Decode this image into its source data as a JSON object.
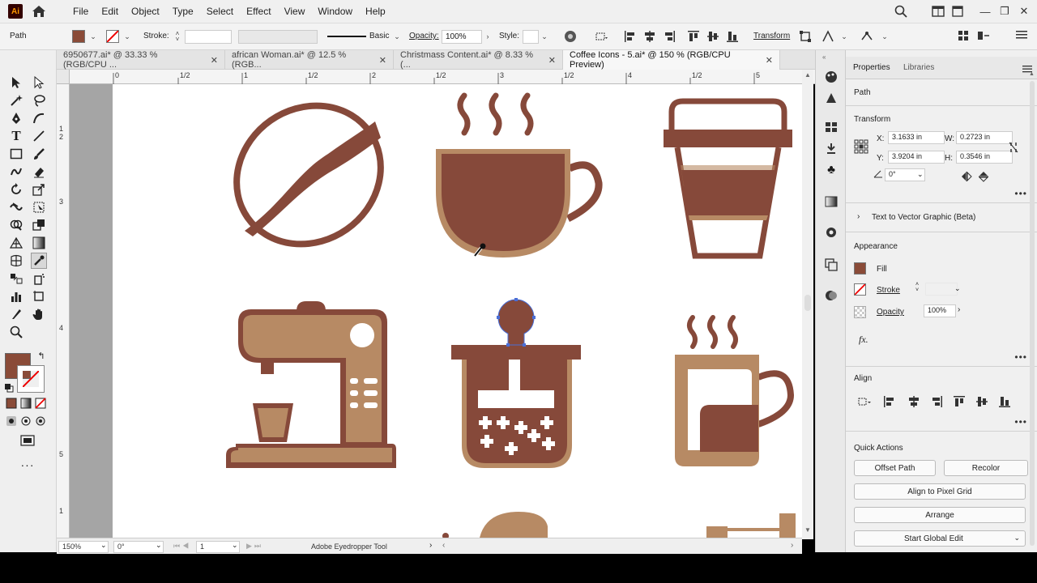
{
  "app": {
    "logo_text": "Ai"
  },
  "menu": [
    "File",
    "Edit",
    "Object",
    "Type",
    "Select",
    "Effect",
    "View",
    "Window",
    "Help"
  ],
  "control_bar": {
    "selection_type": "Path",
    "stroke_label": "Stroke:",
    "brush_label": "Basic",
    "opacity_label": "Opacity:",
    "opacity_value": "100%",
    "style_label": "Style:",
    "transform_label": "Transform",
    "fill_color": "#8a4b38"
  },
  "tabs": [
    {
      "label": "6950677.ai* @ 33.33 % (RGB/CPU ..."
    },
    {
      "label": "african Woman.ai* @ 12.5 % (RGB..."
    },
    {
      "label": "Christmass Content.ai* @ 8.33 % (..."
    },
    {
      "label": "Coffee Icons - 5.ai* @ 150 % (RGB/CPU Preview)"
    }
  ],
  "ruler": {
    "h_labels": [
      "0",
      "1/2",
      "1",
      "1/2",
      "2",
      "1/2",
      "3",
      "1/2",
      "4",
      "1/2",
      "5"
    ],
    "v_labels": [
      "1",
      "2",
      "3",
      "4",
      "5",
      "1"
    ]
  },
  "status": {
    "zoom": "150%",
    "rotation": "0°",
    "artboard": "1",
    "tool_name": "Adobe Eyedropper Tool"
  },
  "panel": {
    "tab_properties": "Properties",
    "tab_libraries": "Libraries",
    "selection": "Path",
    "transform_title": "Transform",
    "x_label": "X:",
    "x_value": "3.1633 in",
    "y_label": "Y:",
    "y_value": "3.9204 in",
    "w_label": "W:",
    "w_value": "0.2723 in",
    "h_label": "H:",
    "h_value": "0.3546 in",
    "angle_value": "0°",
    "text_to_vector": "Text to Vector Graphic (Beta)",
    "appearance_title": "Appearance",
    "fill_label": "Fill",
    "stroke_label": "Stroke",
    "opacity_label": "Opacity",
    "opacity_value": "100%",
    "fx_label": "fx.",
    "align_title": "Align",
    "quick_actions_title": "Quick Actions",
    "btn_offset_path": "Offset Path",
    "btn_recolor": "Recolor",
    "btn_align_pixel": "Align to Pixel Grid",
    "btn_arrange": "Arrange",
    "btn_global_edit": "Start Global Edit"
  },
  "colors": {
    "dark_brown": "#86493a",
    "light_brown": "#b78a64",
    "cream": "#f0e6d6",
    "selection_blue": "#4a6ed6"
  }
}
